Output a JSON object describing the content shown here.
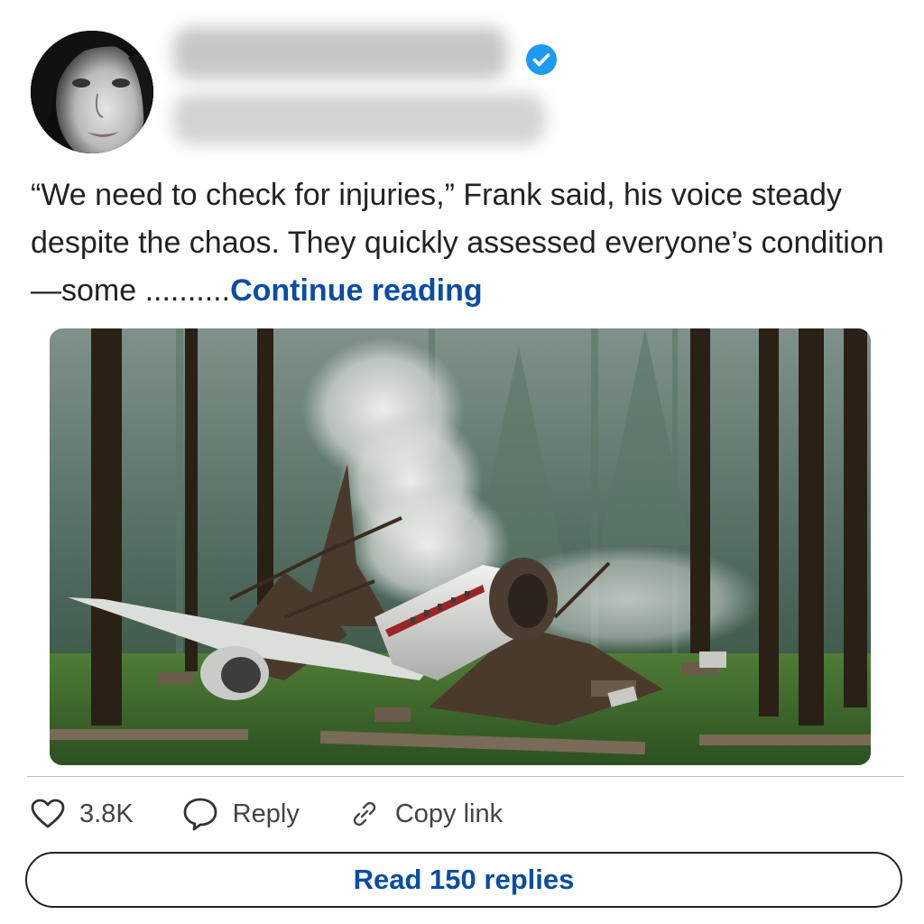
{
  "post": {
    "text_before": "“We need to check for injuries,” Frank said, his voice steady despite the chaos. They quickly assessed everyone’s condition—some ..........",
    "continue_label": "Continue reading",
    "image_alt": "Plane crash wreckage in a smoky forest"
  },
  "author": {
    "verified": true,
    "verified_icon": "verified-check-icon",
    "colors": {
      "badge": "#1d9bf0"
    }
  },
  "actions": {
    "likes": "3.8K",
    "reply_label": "Reply",
    "copy_link_label": "Copy link"
  },
  "footer": {
    "read_replies_label": "Read 150 replies"
  },
  "colors": {
    "link": "#0b4da2",
    "text": "#222222",
    "divider": "#bdbdbd"
  }
}
